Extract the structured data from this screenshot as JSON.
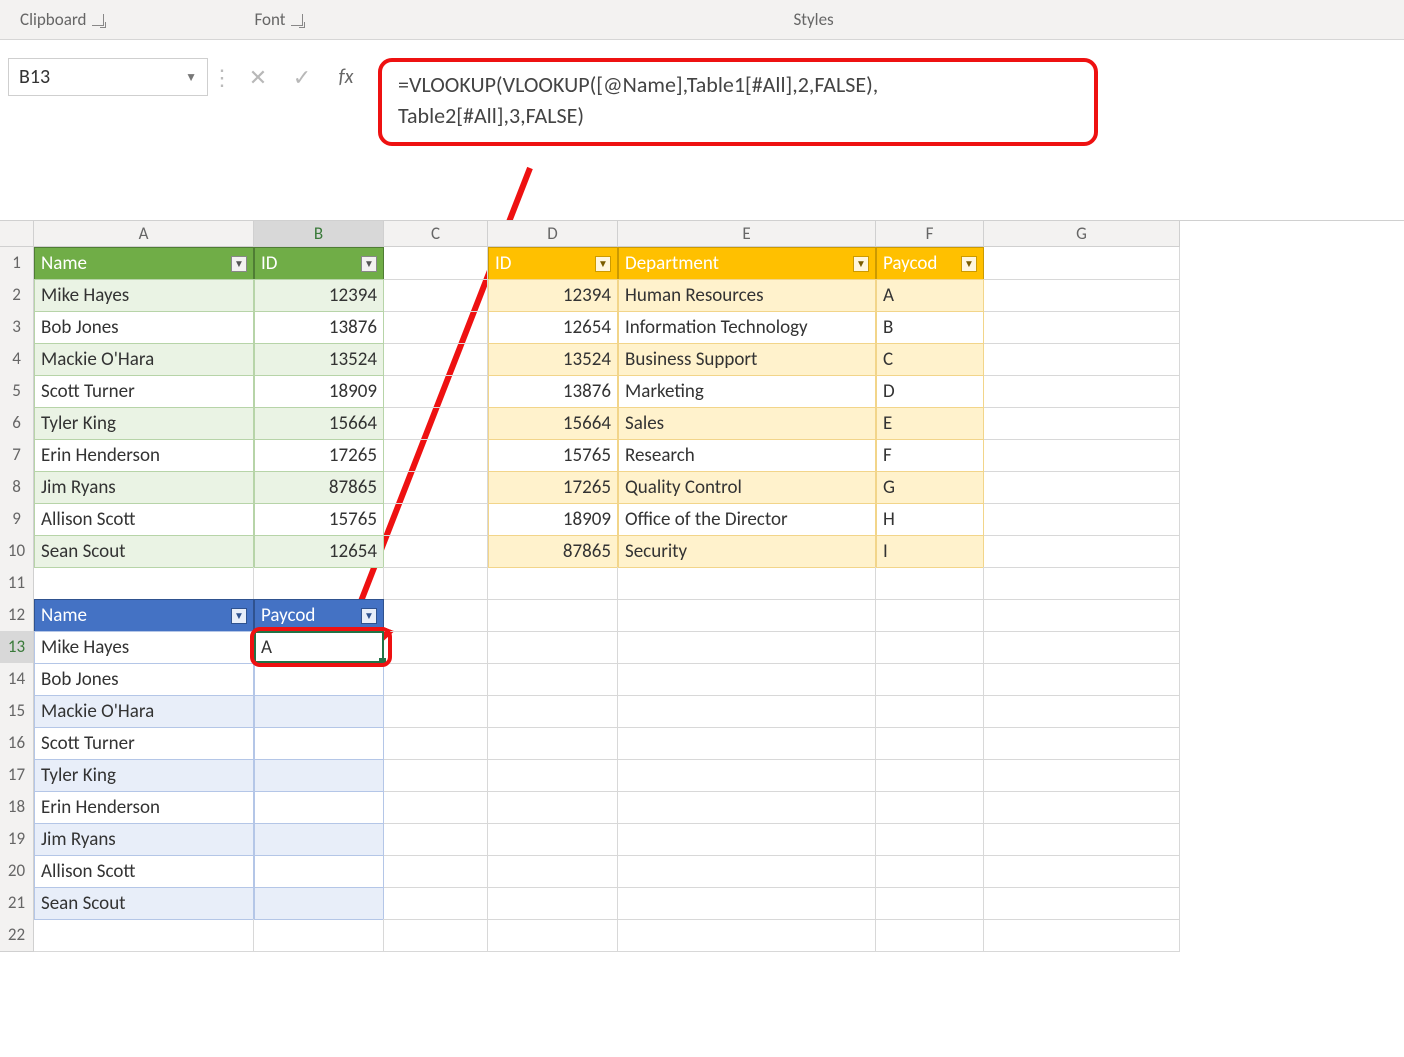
{
  "ribbon": {
    "group_clipboard": "Clipboard",
    "group_font": "Font",
    "group_styles": "Styles"
  },
  "fbar": {
    "cell_ref": "B13",
    "fx_label": "fx",
    "formula_line1": "=VLOOKUP(VLOOKUP([@Name],Table1[#All],2,FALSE),",
    "formula_line2": "Table2[#All],3,FALSE)"
  },
  "columns": [
    "A",
    "B",
    "C",
    "D",
    "E",
    "F",
    "G"
  ],
  "table1": {
    "headers": [
      "Name",
      "ID"
    ],
    "rows": [
      {
        "name": "Mike Hayes",
        "id": "12394"
      },
      {
        "name": "Bob Jones",
        "id": "13876"
      },
      {
        "name": "Mackie O'Hara",
        "id": "13524"
      },
      {
        "name": "Scott Turner",
        "id": "18909"
      },
      {
        "name": "Tyler King",
        "id": "15664"
      },
      {
        "name": "Erin Henderson",
        "id": "17265"
      },
      {
        "name": "Jim Ryans",
        "id": "87865"
      },
      {
        "name": "Allison Scott",
        "id": "15765"
      },
      {
        "name": "Sean Scout",
        "id": "12654"
      }
    ]
  },
  "table2": {
    "headers": [
      "ID",
      "Department",
      "Paycode"
    ],
    "header_paycode_trunc": "Paycod",
    "rows": [
      {
        "id": "12394",
        "dept": "Human Resources",
        "code": "A"
      },
      {
        "id": "12654",
        "dept": "Information Technology",
        "code": "B"
      },
      {
        "id": "13524",
        "dept": "Business Support",
        "code": "C"
      },
      {
        "id": "13876",
        "dept": "Marketing",
        "code": "D"
      },
      {
        "id": "15664",
        "dept": "Sales",
        "code": "E"
      },
      {
        "id": "15765",
        "dept": "Research",
        "code": "F"
      },
      {
        "id": "17265",
        "dept": "Quality Control",
        "code": "G"
      },
      {
        "id": "18909",
        "dept": "Office of the Director",
        "code": "H"
      },
      {
        "id": "87865",
        "dept": "Security",
        "code": "I"
      }
    ]
  },
  "table3": {
    "headers": [
      "Name",
      "Paycode"
    ],
    "header_paycode_trunc": "Paycod",
    "rows": [
      {
        "name": "Mike Hayes",
        "code": "A"
      },
      {
        "name": "Bob Jones",
        "code": ""
      },
      {
        "name": "Mackie O'Hara",
        "code": ""
      },
      {
        "name": "Scott Turner",
        "code": ""
      },
      {
        "name": "Tyler King",
        "code": ""
      },
      {
        "name": "Erin Henderson",
        "code": ""
      },
      {
        "name": "Jim Ryans",
        "code": ""
      },
      {
        "name": "Allison Scott",
        "code": ""
      },
      {
        "name": "Sean Scout",
        "code": ""
      }
    ]
  }
}
